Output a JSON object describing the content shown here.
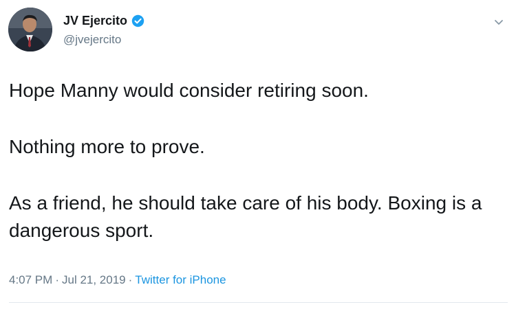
{
  "author": {
    "name": "JV Ejercito",
    "handle": "@jvejercito",
    "verified": true,
    "avatar_icon": "profile-photo-icon"
  },
  "tweet": {
    "paragraphs": [
      "Hope Manny would consider retiring soon.",
      "Nothing more to prove.",
      "As a friend, he should take care of his body.  Boxing is a dangerous sport."
    ]
  },
  "meta": {
    "time": "4:07 PM",
    "date": "Jul 21, 2019",
    "separator": "·",
    "source": "Twitter for iPhone"
  },
  "menu": {
    "icon": "chevron-down-icon"
  },
  "colors": {
    "text": "#14171a",
    "muted": "#657786",
    "link": "#1b95e0",
    "verified": "#1da1f2"
  }
}
